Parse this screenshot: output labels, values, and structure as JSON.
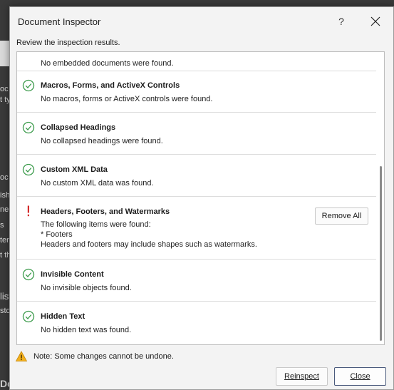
{
  "background": {
    "fragments": [
      "oc",
      "t ty",
      "oc",
      "ishi",
      "nen",
      "s",
      "ters",
      "t th",
      "list",
      "sto",
      "e",
      "e"
    ],
    "bottom_text": "Document"
  },
  "dialog": {
    "title": "Document Inspector",
    "help": "?",
    "subtitle": "Review the inspection results.",
    "items": [
      {
        "status": "ok",
        "text": "No embedded documents were found."
      },
      {
        "status": "ok",
        "title": "Macros, Forms, and ActiveX Controls",
        "text": "No macros, forms or ActiveX controls were found."
      },
      {
        "status": "ok",
        "title": "Collapsed Headings",
        "text": "No collapsed headings were found."
      },
      {
        "status": "ok",
        "title": "Custom XML Data",
        "text": "No custom XML data was found."
      },
      {
        "status": "warning",
        "title": "Headers, Footers, and Watermarks",
        "lines": [
          "The following items were found:",
          "* Footers",
          "Headers and footers may include shapes such as watermarks."
        ],
        "action": "Remove All"
      },
      {
        "status": "ok",
        "title": "Invisible Content",
        "text": "No invisible objects found."
      },
      {
        "status": "ok",
        "title": "Hidden Text",
        "text": "No hidden text was found."
      }
    ],
    "note": "Note: Some changes cannot be undone.",
    "buttons": {
      "reinspect": "Reinspect",
      "close": "Close"
    }
  },
  "colors": {
    "ok_icon": "#3a9a4a",
    "warning_icon": "#d42a2a",
    "note_icon": "#e8a317"
  }
}
